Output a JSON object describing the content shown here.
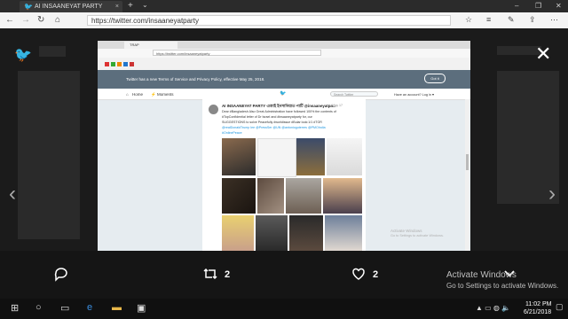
{
  "browser": {
    "tab_title": "AI INSAANEYAT PARTY",
    "tab_close": "×",
    "new_tab": "+",
    "tab_menu": "⌄",
    "address": "https://twitter.com/insaaneyatparty",
    "window_controls": [
      "–",
      "❐",
      "✕"
    ]
  },
  "shot": {
    "tab_title": "TRAP",
    "url": "https://twitter.com/insaaneyatparty",
    "banner_text": "Twitter has a new Terms of Service and Privacy Policy, effective May 25, 2018.",
    "banner_button": "Got it",
    "nav": [
      "Home",
      "Moments"
    ],
    "search_placeholder": "Search Twitter",
    "have_account": "Have an account? Log in ▾",
    "tweet": {
      "name": "AI INSAANEYAT PARTY এআই ইনসানিয়াত পার্টি @insaaneyatpa...",
      "date": "· May 17",
      "lines": [
        "Dear #Bangladesh Also Great Administration have followed 100% the contents of",
        "#TopConfidential letter of Dr Israel and #insaaneyatparty for, our",
        "SUGGESTIONS to solve Peacefully #worldissue #Bular look:1/1 #TGR",
        "@realDonaldTrump lee @PressSer @UN @antonioguterres @PMOIndia",
        "#OnlinePeace"
      ]
    },
    "watermark_title": "Activate Windows",
    "watermark_sub": "Go to Settings to activate Windows."
  },
  "viewer": {
    "close": "✕",
    "prev": "‹",
    "next": "›"
  },
  "actions": {
    "retweet_count": "2",
    "like_count": "2"
  },
  "watermark": {
    "title": "Activate Windows",
    "subtitle": "Go to Settings to activate Windows."
  },
  "taskbar": {
    "time": "11:02 PM",
    "date": "6/21/2018"
  }
}
